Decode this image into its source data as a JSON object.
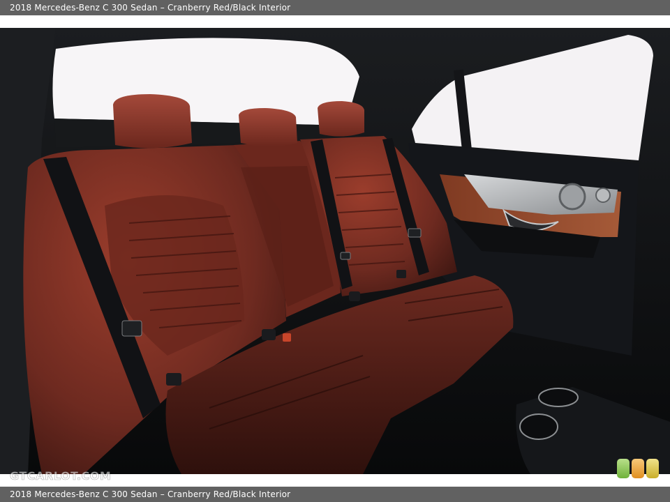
{
  "header": {
    "caption": "2018 Mercedes-Benz C 300 Sedan – Cranberry Red/Black Interior"
  },
  "footer": {
    "caption": "2018 Mercedes-Benz C 300 Sedan – Cranberry Red/Black Interior"
  },
  "photo": {
    "subject": "rear-seat-interior",
    "watermark": "GTCARLOT.COM",
    "colors": {
      "leather": "#7a2e22",
      "leather_dark": "#4a1a14",
      "trim": "#1a1c1f",
      "window": "#f6f4f6",
      "door_accent": "#9a4a2c"
    }
  },
  "badge": {
    "icon": "site-logo-icon"
  }
}
